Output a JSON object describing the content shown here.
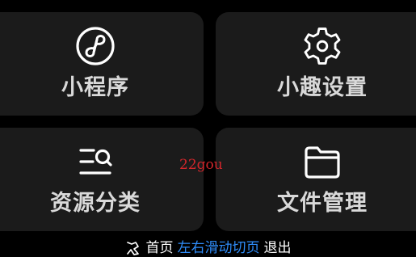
{
  "tiles": {
    "mini_program": {
      "label": "小程序",
      "icon": "mini-program-icon"
    },
    "settings": {
      "label": "小趣设置",
      "icon": "gear-icon"
    },
    "resources": {
      "label": "资源分类",
      "icon": "list-search-icon"
    },
    "files": {
      "label": "文件管理",
      "icon": "folder-icon"
    }
  },
  "watermark": "22gou",
  "footer": {
    "icon": "gesture-swipe-icon",
    "home": "首页",
    "hint": "左右滑动切页",
    "exit": "退出"
  },
  "colors": {
    "background": "#000000",
    "tile": "#1b1b1b",
    "label": "#d9d9d9",
    "hint": "#2f8dfa",
    "watermark": "#d2262b"
  }
}
